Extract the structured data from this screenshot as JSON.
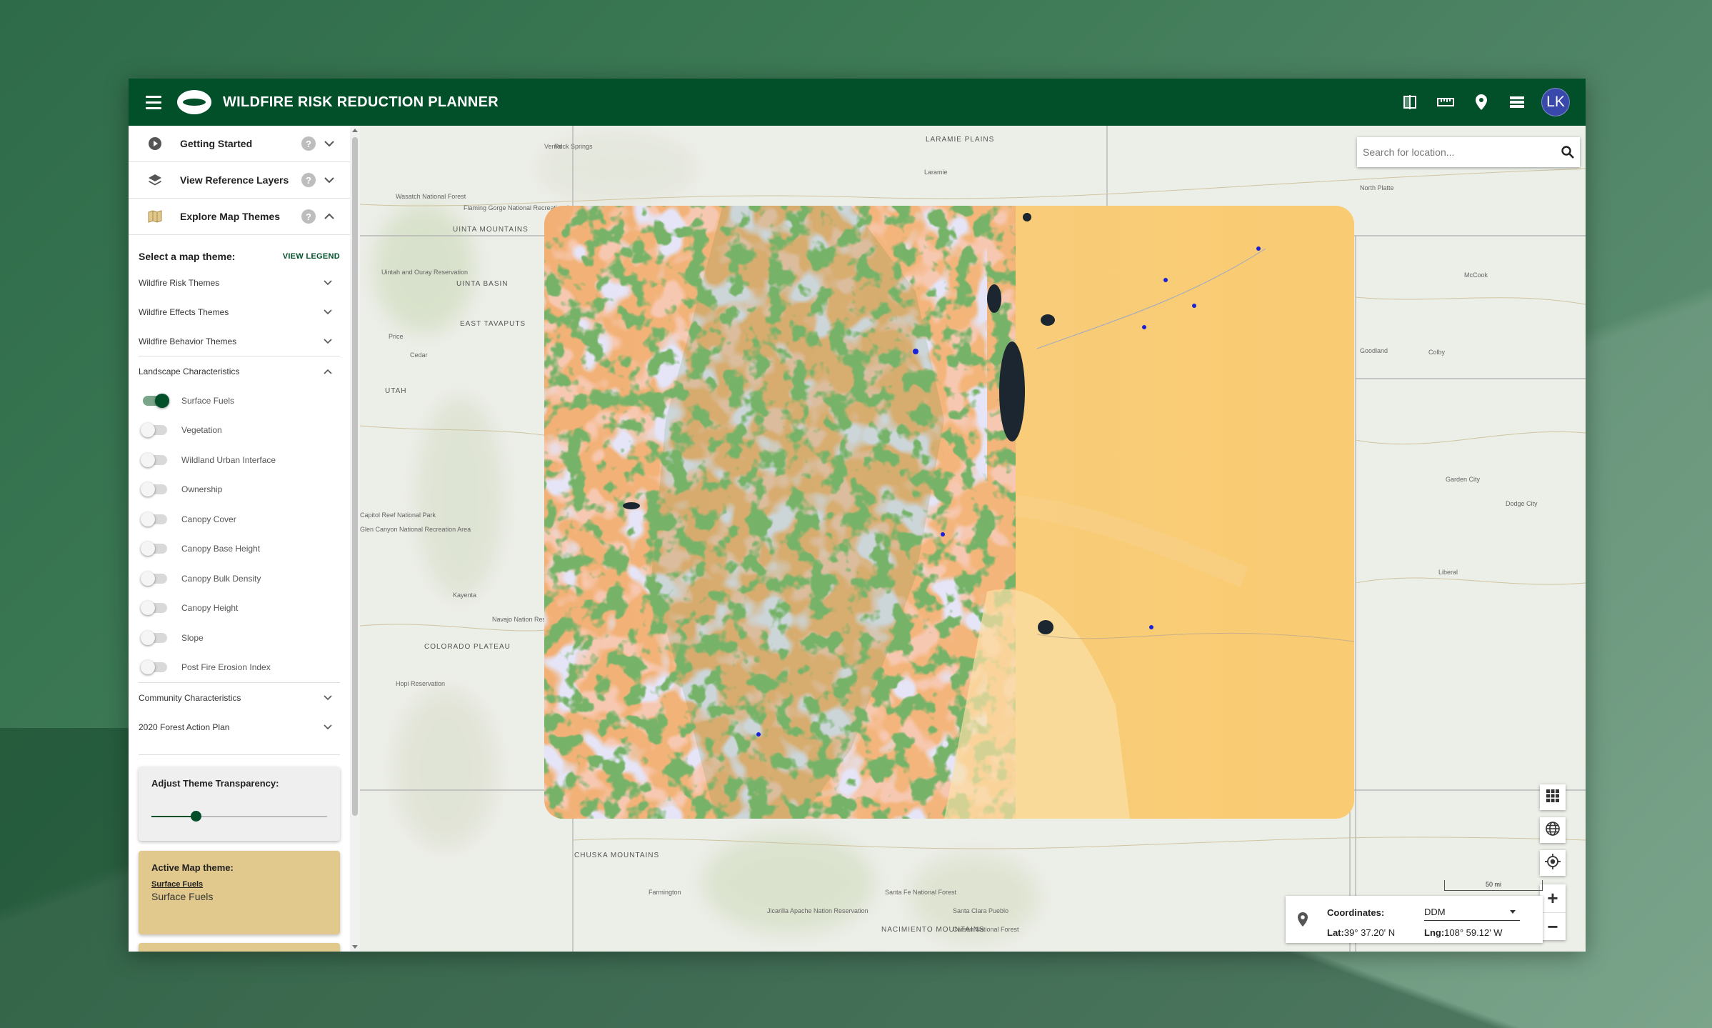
{
  "app": {
    "title": "WILDFIRE RISK REDUCTION PLANNER",
    "user_initials": "LK"
  },
  "colors": {
    "brand": "#02502a",
    "accent_card": "#e1c88c"
  },
  "top_actions": [
    {
      "name": "compare-icon"
    },
    {
      "name": "measure-ruler-icon"
    },
    {
      "name": "location-pin-icon"
    },
    {
      "name": "layers-list-icon"
    }
  ],
  "sidebar": {
    "sections": [
      {
        "label": "Getting Started",
        "icon": "play-circle-icon",
        "expanded": false
      },
      {
        "label": "View Reference Layers",
        "icon": "layers-icon",
        "expanded": false
      },
      {
        "label": "Explore Map Themes",
        "icon": "map-icon",
        "expanded": true
      }
    ],
    "help_symbol": "?",
    "select_theme_label": "Select a map theme:",
    "view_legend_label": "VIEW LEGEND",
    "categories": [
      {
        "label": "Wildfire Risk Themes"
      },
      {
        "label": "Wildfire Effects Themes"
      },
      {
        "label": "Wildfire Behavior Themes"
      }
    ],
    "landscape": {
      "label": "Landscape Characteristics",
      "layers": [
        {
          "label": "Surface Fuels",
          "on": true
        },
        {
          "label": "Vegetation",
          "on": false
        },
        {
          "label": "Wildland Urban Interface",
          "on": false
        },
        {
          "label": "Ownership",
          "on": false
        },
        {
          "label": "Canopy Cover",
          "on": false
        },
        {
          "label": "Canopy Base Height",
          "on": false
        },
        {
          "label": "Canopy Bulk Density",
          "on": false
        },
        {
          "label": "Canopy Height",
          "on": false
        },
        {
          "label": "Slope",
          "on": false
        },
        {
          "label": "Post Fire Erosion Index",
          "on": false
        }
      ]
    },
    "more_categories": [
      {
        "label": "Community Characteristics"
      },
      {
        "label": "2020 Forest Action Plan"
      }
    ],
    "transparency": {
      "label": "Adjust Theme Transparency:",
      "value": 0.25
    },
    "active_theme": {
      "label": "Active Map theme:",
      "link": "Surface Fuels",
      "name": "Surface Fuels"
    }
  },
  "map": {
    "search_placeholder": "Search for location...",
    "scale_label": "50 mi",
    "coordinates": {
      "label": "Coordinates:",
      "format": "DDM",
      "lat_label": "Lat:",
      "lat_value": "39° 37.20' N",
      "lng_label": "Lng:",
      "lng_value": "108° 59.12' W"
    },
    "places": [
      "Rock Springs",
      "LARAMIE PLAINS",
      "Laramie",
      "North Platte",
      "Wasatch National Forest",
      "Flaming Gorge National Recreation Area",
      "Vernal",
      "UINTA MOUNTAINS",
      "UINTA BASIN",
      "Uintah and Ouray Reservation",
      "EAST TAVAPUTS",
      "Price",
      "Cedar",
      "UTAH",
      "McCook",
      "Goodland",
      "Colby",
      "Garden City",
      "Dodge City",
      "Liberal",
      "Kayenta",
      "Farmington",
      "Jicarilla Apache Nation Reservation",
      "Carson National Forest",
      "Navajo Nation Reservation",
      "CHUSKA MOUNTAINS",
      "COLORADO PLATEAU",
      "Santa Fe National Forest",
      "Santa Clara Pueblo",
      "NACIMIENTO MOUNTAINS",
      "Hopi Reservation",
      "Capitol Reef National Park",
      "Glen Canyon National Recreation Area"
    ]
  }
}
